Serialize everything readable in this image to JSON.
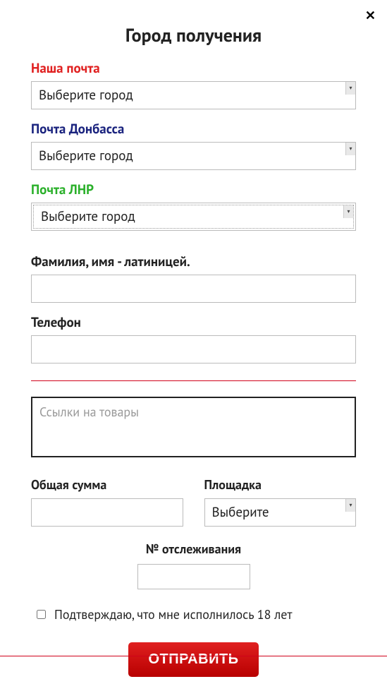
{
  "close_icon": "✕",
  "title": "Город получения",
  "fields": {
    "nasha_pochta": {
      "label": "Наша почта",
      "selected": "Выберите город"
    },
    "pochta_donbassa": {
      "label": "Почта Донбасса",
      "selected": "Выберите город"
    },
    "pochta_lnr": {
      "label": "Почта ЛНР",
      "selected": "Выберите город"
    },
    "fullname": {
      "label": "Фамилия, имя - латиницей.",
      "value": ""
    },
    "phone": {
      "label": "Телефон",
      "value": ""
    },
    "links": {
      "placeholder": "Ссылки на товары",
      "value": ""
    },
    "total": {
      "label": "Общая сумма",
      "value": ""
    },
    "platform": {
      "label": "Площадка",
      "selected": "Выберите"
    },
    "tracking": {
      "label": "№ отслеживания",
      "value": ""
    }
  },
  "confirm_age": {
    "checked": false,
    "label": "Подтверждаю, что мне исполнилось 18 лет"
  },
  "submit_label": "ОТПРАВИТЬ"
}
